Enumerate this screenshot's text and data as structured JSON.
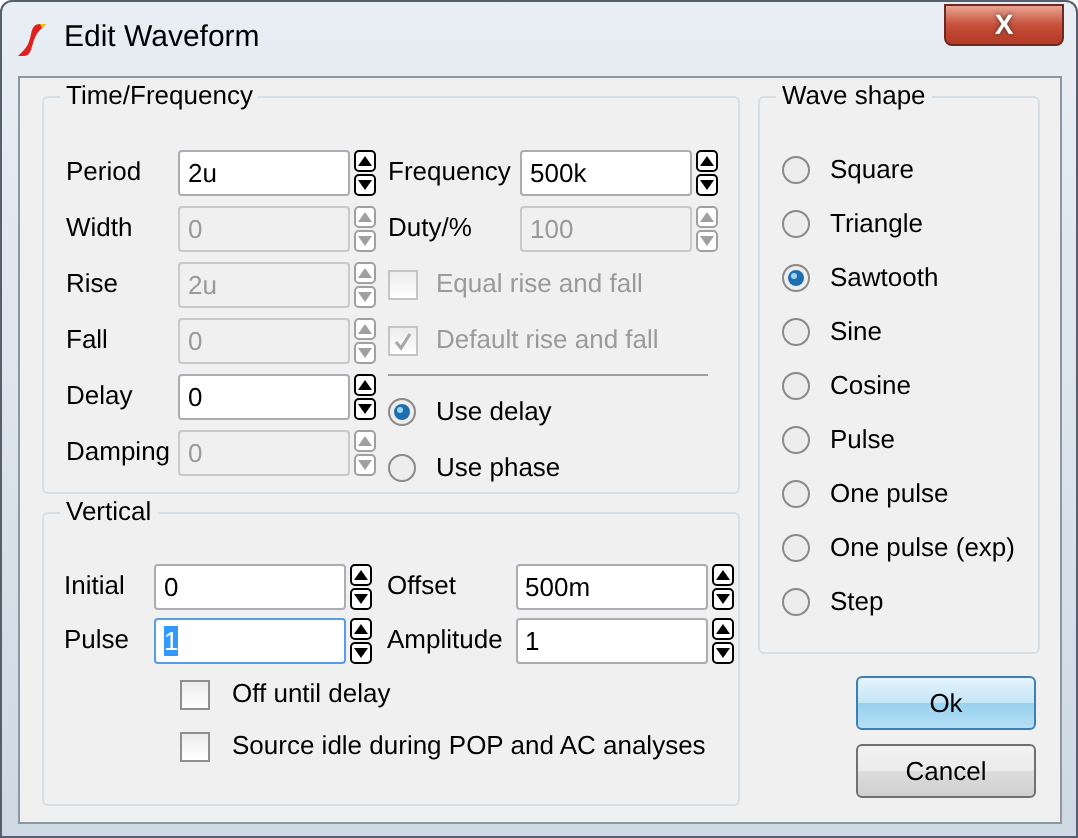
{
  "window": {
    "title": "Edit Waveform",
    "close": "X"
  },
  "time_frequency": {
    "title": "Time/Frequency",
    "left": [
      {
        "label": "Period",
        "value": "2u",
        "disabled": false
      },
      {
        "label": "Width",
        "value": "0",
        "disabled": true
      },
      {
        "label": "Rise",
        "value": "2u",
        "disabled": true
      },
      {
        "label": "Fall",
        "value": "0",
        "disabled": true
      },
      {
        "label": "Delay",
        "value": "0",
        "disabled": false
      },
      {
        "label": "Damping",
        "value": "0",
        "disabled": true
      }
    ],
    "right": [
      {
        "kind": "field",
        "label": "Frequency",
        "value": "500k",
        "disabled": false
      },
      {
        "kind": "field",
        "label": "Duty/%",
        "value": "100",
        "disabled": true
      },
      {
        "kind": "checkbox",
        "label": "Equal rise and fall",
        "checked": false,
        "disabled": true
      },
      {
        "kind": "checkbox",
        "label": "Default rise and fall",
        "checked": true,
        "disabled": true
      },
      {
        "kind": "radio",
        "label": "Use delay",
        "selected": true,
        "disabled": false
      },
      {
        "kind": "radio",
        "label": "Use phase",
        "selected": false,
        "disabled": false
      }
    ]
  },
  "vertical": {
    "title": "Vertical",
    "fields": [
      {
        "label": "Initial",
        "value": "0",
        "focused": false
      },
      {
        "label": "Offset",
        "value": "500m",
        "focused": false
      },
      {
        "label": "Pulse",
        "value": "1",
        "focused": true
      },
      {
        "label": "Amplitude",
        "value": "1",
        "focused": false
      }
    ],
    "checkboxes": [
      {
        "label": "Off until delay",
        "checked": false
      },
      {
        "label": "Source idle during POP and AC analyses",
        "checked": false
      }
    ]
  },
  "wave_shape": {
    "title": "Wave shape",
    "options": [
      {
        "label": "Square",
        "selected": false
      },
      {
        "label": "Triangle",
        "selected": false
      },
      {
        "label": "Sawtooth",
        "selected": true
      },
      {
        "label": "Sine",
        "selected": false
      },
      {
        "label": "Cosine",
        "selected": false
      },
      {
        "label": "Pulse",
        "selected": false
      },
      {
        "label": "One pulse",
        "selected": false
      },
      {
        "label": "One pulse (exp)",
        "selected": false
      },
      {
        "label": "Step",
        "selected": false
      }
    ]
  },
  "buttons": [
    {
      "label": "Ok",
      "default": true
    },
    {
      "label": "Cancel",
      "default": false
    }
  ]
}
